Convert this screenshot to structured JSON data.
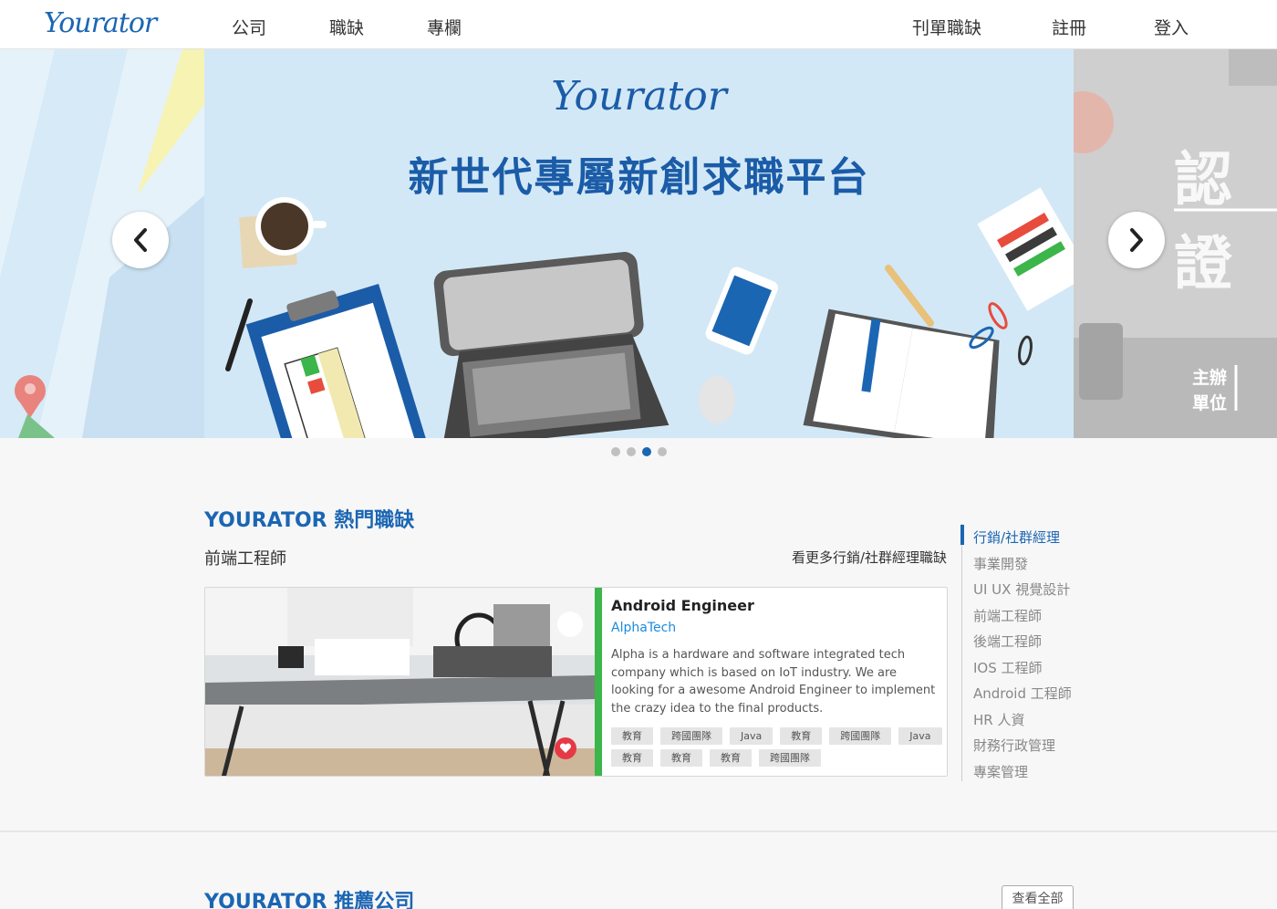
{
  "header": {
    "logo_lead": "Y",
    "logo_rest": "ourator",
    "nav_left": [
      "公司",
      "職缺",
      "專欄"
    ],
    "nav_right": [
      "刊單職缺",
      "註冊",
      "登入"
    ]
  },
  "hero": {
    "logo_text": "Yourator",
    "title": "新世代專屬新創求職平台",
    "right_text": "認證",
    "right_small_1": "主辦",
    "right_small_2": "單位",
    "slides_count": 4,
    "active_slide": 3
  },
  "hot_jobs": {
    "section_title": "YOURATOR 熱門職缺",
    "category_heading": "前端工程師",
    "more_link": "看更多行銷/社群經理職缺",
    "job": {
      "title": "Android Engineer",
      "company": "AlphaTech",
      "description": "Alpha is a hardware and software integrated tech company which is based on IoT industry. We are looking for a awesome Android Engineer to implement the crazy idea to the final products.",
      "tags": [
        "教育",
        "跨國團隊",
        "Java",
        "教育",
        "跨國團隊",
        "Java",
        "教育",
        "教育",
        "教育",
        "跨國團隊"
      ]
    },
    "side_categories": [
      "行銷/社群經理",
      "事業開發",
      "UI UX 視覺設計",
      "前端工程師",
      "後端工程師",
      "IOS 工程師",
      "Android 工程師",
      "HR 人資",
      "財務行政管理",
      "專案管理"
    ],
    "active_category": "行銷/社群經理"
  },
  "recommended": {
    "section_title": "YOURATOR 推薦公司",
    "view_all": "查看全部"
  },
  "colors": {
    "brand_blue": "#1b66b3",
    "hero_bg": "#d3e8f6",
    "green_accent": "#3cb54a",
    "heart_red": "#e63946"
  }
}
